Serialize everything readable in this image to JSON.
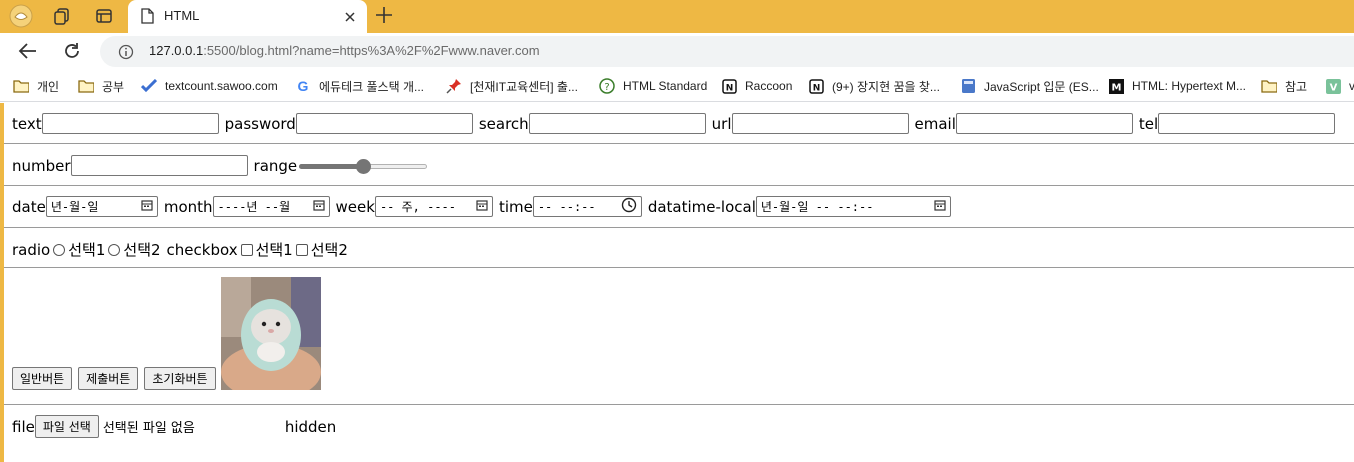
{
  "browser": {
    "tab_title": "HTML",
    "url_host": "127.0.0.1",
    "url_rest": ":5500/blog.html?name=https%3A%2F%2Fwww.naver.com",
    "accent": "#eeb844",
    "bookmarks": [
      {
        "label": "개인",
        "icon": "folder-icon"
      },
      {
        "label": "공부",
        "icon": "folder-icon"
      },
      {
        "label": "textcount.sawoo.com",
        "icon": "check-mark-icon"
      },
      {
        "label": "에듀테크 풀스택 개...",
        "icon": "google-icon"
      },
      {
        "label": "[천재IT교육센터] 출...",
        "icon": "pin-icon"
      },
      {
        "label": "HTML Standard",
        "icon": "question-circle-icon"
      },
      {
        "label": "Raccoon",
        "icon": "notion-icon"
      },
      {
        "label": "(9+) 장지현 꿈을 찾...",
        "icon": "notion-icon"
      },
      {
        "label": "JavaScript 입문 (ES...",
        "icon": "book-icon"
      },
      {
        "label": "HTML: Hypertext M...",
        "icon": "mdn-icon"
      },
      {
        "label": "참고",
        "icon": "folder-icon"
      },
      {
        "label": "v",
        "icon": "v-icon"
      }
    ]
  },
  "form": {
    "row1": {
      "text": "text",
      "password": "password",
      "search": "search",
      "url": "url",
      "email": "email",
      "tel": "tel"
    },
    "row2": {
      "number": "number",
      "range": "range",
      "range_value_fraction": 0.5
    },
    "row3": {
      "date": "date",
      "date_placeholder": "년-월-일",
      "month": "month",
      "month_placeholder": "----년 --월",
      "week": "week",
      "week_placeholder": "-- 주, ----",
      "time": "time",
      "time_placeholder": "-- --:--",
      "datetime": "datatime-local",
      "datetime_placeholder": "년-월-일 -- --:--"
    },
    "row4": {
      "radio": "radio",
      "radio_opt1": "선택1",
      "radio_opt2": "선택2",
      "checkbox": "checkbox",
      "check_opt1": "선택1",
      "check_opt2": "선택2"
    },
    "row5": {
      "button_normal": "일반버튼",
      "button_submit": "제출버튼",
      "button_reset": "초기화버튼"
    },
    "row6": {
      "file": "file",
      "file_button": "파일 선택",
      "file_status": "선택된 파일 없음",
      "hidden": "hidden"
    }
  }
}
